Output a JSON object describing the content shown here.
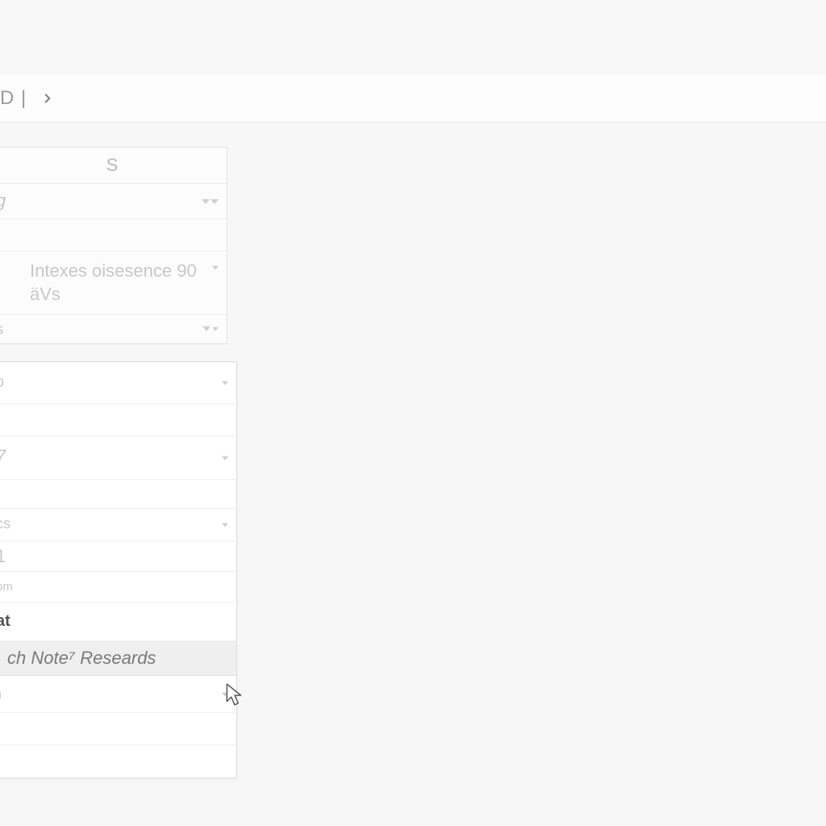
{
  "breadcrumb": {
    "fragment": "D |"
  },
  "sidebar": {
    "column_header": "S",
    "row_labels": {
      "r0": "g",
      "r2": "s",
      "r3": "p",
      "r4": "7",
      "r5": "cs",
      "r6": "1",
      "r7": "om",
      "r8": "at",
      "r10": ")"
    },
    "cell_text": {
      "intexes": "Intexes oisesence 90 äVs"
    },
    "hover_row": "ch Note⁷ Researds"
  }
}
